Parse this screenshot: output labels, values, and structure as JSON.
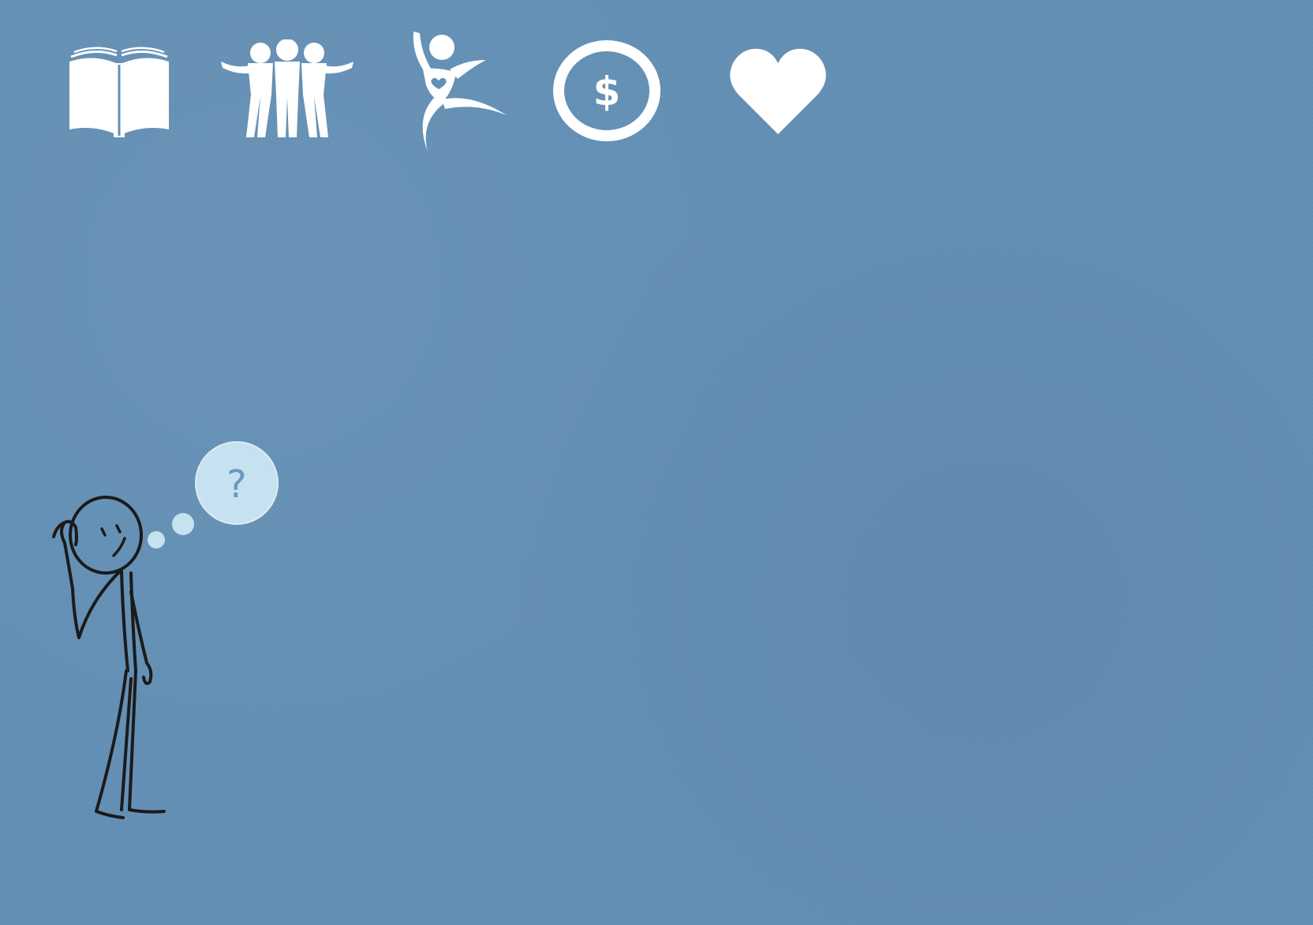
{
  "canvas": {
    "background_color": "#6390b5"
  },
  "icons": [
    {
      "name": "open-book-icon",
      "color": "#ffffff"
    },
    {
      "name": "group-of-people-icon",
      "color": "#ffffff"
    },
    {
      "name": "dancing-person-heart-icon",
      "color": "#ffffff"
    },
    {
      "name": "dollar-coin-icon",
      "color": "#ffffff",
      "symbol": "$"
    },
    {
      "name": "heart-icon",
      "color": "#ffffff"
    }
  ],
  "illustration": {
    "name": "thinking-stick-figure",
    "thought_bubble": {
      "symbol": "?",
      "fill_color": "#c6e1ef",
      "symbol_color": "#6a98bd"
    },
    "line_color": "#1b1b1b"
  }
}
